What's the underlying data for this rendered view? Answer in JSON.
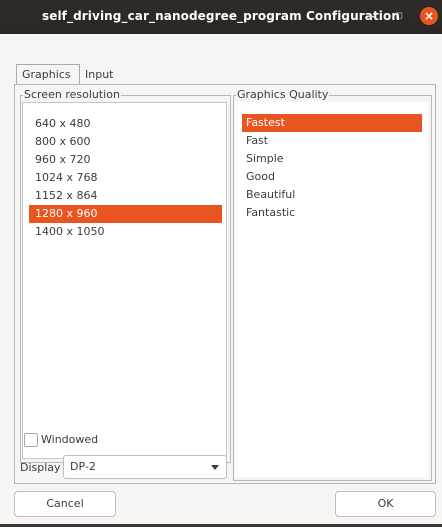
{
  "window": {
    "title": "self_driving_car_nanodegree_program Configuration",
    "min_glyph": "–",
    "max_glyph": "◻",
    "close_glyph": "×"
  },
  "tabs": [
    {
      "label": "Graphics",
      "active": true
    },
    {
      "label": "Input",
      "active": false
    }
  ],
  "screen_resolution": {
    "title": "Screen resolution",
    "items": [
      "640 x 480",
      "800 x 600",
      "960 x 720",
      "1024 x 768",
      "1152 x 864",
      "1280 x 960",
      "1400 x 1050"
    ],
    "selected": "1280 x 960"
  },
  "graphics_quality": {
    "title": "Graphics Quality",
    "items": [
      "Fastest",
      "Fast",
      "Simple",
      "Good",
      "Beautiful",
      "Fantastic"
    ],
    "selected": "Fastest"
  },
  "windowed": {
    "label": "Windowed",
    "checked": false
  },
  "display": {
    "label": "Display",
    "value": "DP-2"
  },
  "buttons": {
    "cancel": "Cancel",
    "ok": "OK"
  },
  "colors": {
    "accent": "#e95420",
    "titlebar": "#2d2927",
    "window_bg": "#f6f5f4"
  }
}
